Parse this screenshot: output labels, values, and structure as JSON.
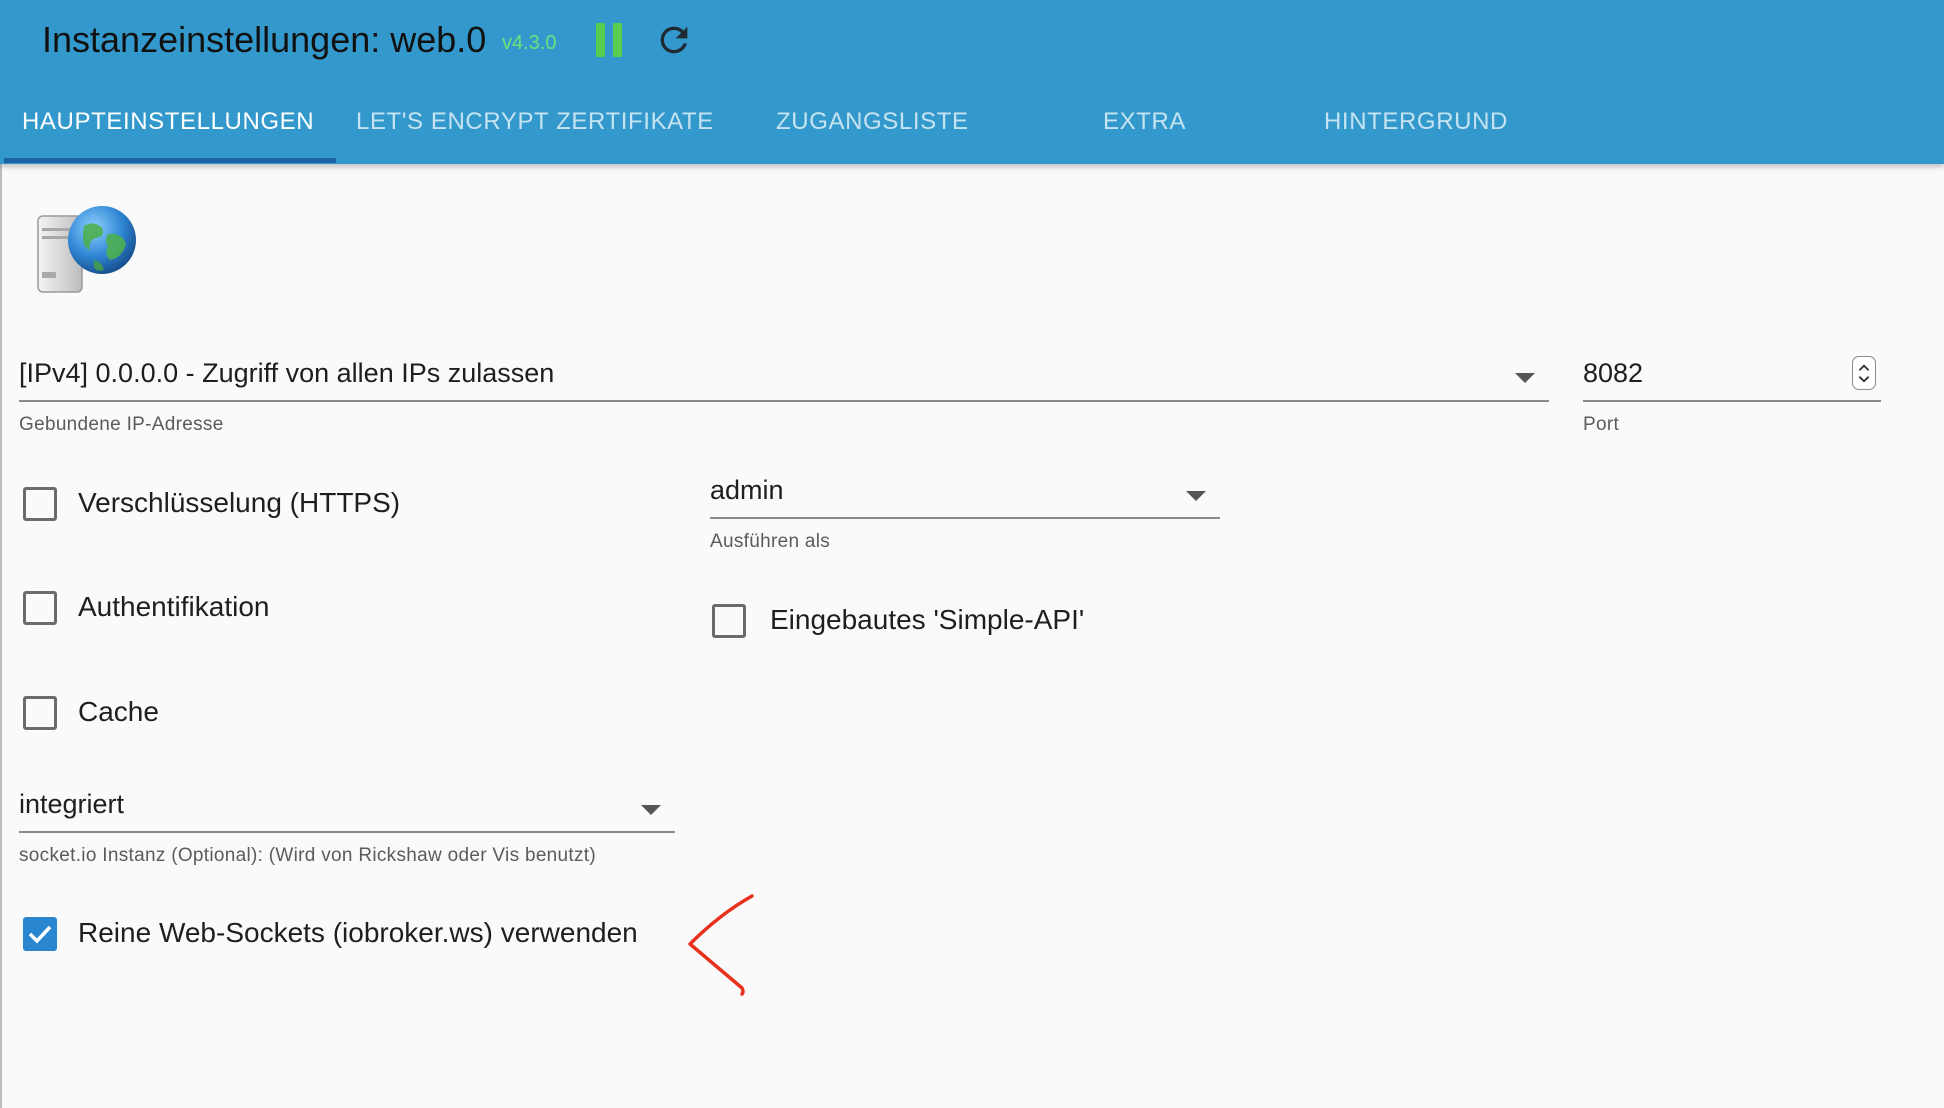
{
  "header": {
    "title": "Instanzeinstellungen: web.0",
    "version": "v4.3.0",
    "pause_icon": "pause-icon",
    "refresh_icon": "refresh-icon"
  },
  "tabs": [
    {
      "label": "HAUPTEINSTELLUNGEN",
      "active": true
    },
    {
      "label": "LET'S ENCRYPT ZERTIFIKATE",
      "active": false
    },
    {
      "label": "ZUGANGSLISTE",
      "active": false
    },
    {
      "label": "EXTRA",
      "active": false
    },
    {
      "label": "HINTERGRUND",
      "active": false
    }
  ],
  "logo_icon": "server-globe-icon",
  "bind_ip": {
    "value": "[IPv4] 0.0.0.0 - Zugriff von allen IPs zulassen",
    "helper": "Gebundene IP-Adresse"
  },
  "port": {
    "value": "8082",
    "helper": "Port"
  },
  "run_as": {
    "value": "admin",
    "helper": "Ausführen als"
  },
  "checkboxes": {
    "https": {
      "label": "Verschlüsselung (HTTPS)",
      "checked": false
    },
    "auth": {
      "label": "Authentifikation",
      "checked": false
    },
    "cache": {
      "label": "Cache",
      "checked": false
    },
    "simple_api": {
      "label": "Eingebautes 'Simple-API'",
      "checked": false
    },
    "pure_ws": {
      "label": "Reine Web-Sockets (iobroker.ws) verwenden",
      "checked": true
    }
  },
  "socketio": {
    "value": "integriert",
    "helper": "socket.io Instanz (Optional): (Wird von Rickshaw oder Vis benutzt)"
  },
  "colors": {
    "appbar": "#3399cc",
    "tab_indicator": "#1a64a6",
    "checkbox_checked": "#2a87cf",
    "version": "#6ee07b",
    "pause": "#57cc4f",
    "annotation": "#e8321e"
  }
}
